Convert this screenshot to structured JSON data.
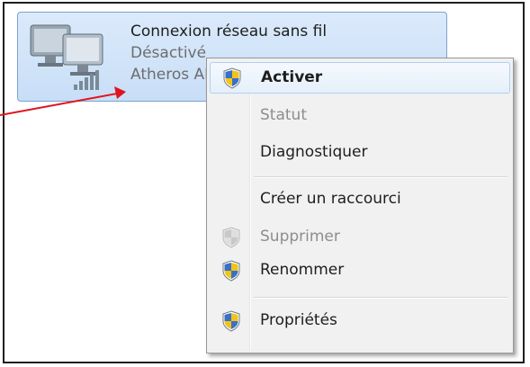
{
  "network_tile": {
    "name": "Connexion réseau sans fil",
    "status": "Désactivé",
    "device": "Atheros AR"
  },
  "context_menu": {
    "items": [
      {
        "label": "Activer",
        "icon": "uac-shield-icon",
        "style": "bold-highlighted"
      },
      {
        "label": "Statut",
        "icon": "",
        "style": "disabled"
      },
      {
        "label": "Diagnostiquer",
        "icon": "",
        "style": "normal"
      },
      {
        "label": "Créer un raccourci",
        "icon": "",
        "style": "normal"
      },
      {
        "label": "Supprimer",
        "icon": "uac-shield-disabled-icon",
        "style": "disabled"
      },
      {
        "label": "Renommer",
        "icon": "uac-shield-icon",
        "style": "normal"
      },
      {
        "label": "Propriétés",
        "icon": "uac-shield-icon",
        "style": "normal"
      }
    ]
  },
  "colors": {
    "annotation_arrow": "#e0141e",
    "tile_background": "#cfe2f8",
    "menu_background": "#f1f1f1"
  }
}
